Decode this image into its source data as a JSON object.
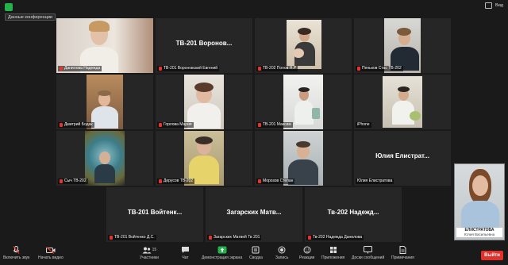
{
  "topbar": {
    "conf_info_label": "Данные конференции",
    "view_label": "Вид"
  },
  "tiles": [
    {
      "label": "Данилова Надежда",
      "big_name": ""
    },
    {
      "label": "ТВ-201 Вороновский Евгений",
      "big_name": "ТВ-201 Воронов..."
    },
    {
      "label": "ТВ-202 Попов Н.Р",
      "big_name": ""
    },
    {
      "label": "Пеньков Стас ТВ-202",
      "big_name": ""
    },
    {
      "label": "Дмитрий Бодак",
      "big_name": ""
    },
    {
      "label": "Горлова Мария",
      "big_name": ""
    },
    {
      "label": "ТВ-201 Максим",
      "big_name": ""
    },
    {
      "label": "iPhone",
      "big_name": ""
    },
    {
      "label": "Сыч ТВ-202",
      "big_name": ""
    },
    {
      "label": "Дерусов ТВ-202",
      "big_name": ""
    },
    {
      "label": "Морозов Степан",
      "big_name": ""
    },
    {
      "label": "Юлия Елистратова",
      "big_name": "Юлия Елистрат..."
    },
    {
      "label": "ТВ-201 Войтенко Д.С.",
      "big_name": "ТВ-201 Войтенк..."
    },
    {
      "label": "Загарских Матвей Тв 201",
      "big_name": "Загарских Матв..."
    },
    {
      "label": "Тв-202 Надежда Данилова",
      "big_name": "Тв-202 Надежд..."
    }
  ],
  "self_view": {
    "name": "ЕЛИСТРАТОВА",
    "subname": "Юлия Васильевна"
  },
  "toolbar": {
    "mic_label": "Включить звук",
    "video_label": "Начать видео",
    "participants_label": "Участники",
    "participants_count": "15",
    "chat_label": "Чат",
    "share_label": "Демонстрация экрана",
    "record_label": "Запись",
    "summary_label": "Сводка",
    "reactions_label": "Реакции",
    "apps_label": "Приложения",
    "whiteboard_label": "Доски сообщений",
    "notes_label": "Примечания",
    "leave_label": "Выйти"
  },
  "colors": {
    "accent_green": "#23b24b",
    "highlight": "#b8d75a",
    "leave_red": "#e0312b",
    "mute_red": "#e5342b"
  }
}
